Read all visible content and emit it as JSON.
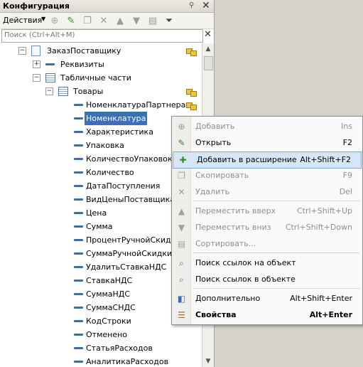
{
  "window": {
    "title": "Конфигурация"
  },
  "toolbar": {
    "actions_label": "Действия"
  },
  "search": {
    "placeholder": "Поиск (Ctrl+Alt+M)"
  },
  "tree": {
    "root": "ЗаказПоставщику",
    "requisites": "Реквизиты",
    "tabular_parts": "Табличные части",
    "table_goods": "Товары",
    "attributes": [
      "НоменклатураПартнера",
      "Номенклатура",
      "Характеристика",
      "Упаковка",
      "КоличествоУпаковок",
      "Количество",
      "ДатаПоступления",
      "ВидЦеныПоставщика",
      "Цена",
      "Сумма",
      "ПроцентРучнойСкидки",
      "СуммаРучнойСкидки",
      "УдалитьСтавкаНДС",
      "СтавкаНДС",
      "СуммаНДС",
      "СуммаСНДС",
      "КодСтроки",
      "Отменено",
      "СтатьяРасходов",
      "АналитикаРасходов"
    ]
  },
  "context_menu": {
    "items": [
      {
        "label": "Добавить",
        "shortcut": "Ins",
        "icon": "add-icon",
        "disabled": true
      },
      {
        "label": "Открыть",
        "shortcut": "F2",
        "icon": "pencil-icon",
        "disabled": false
      },
      {
        "label": "Добавить в расширение",
        "shortcut": "Alt+Shift+F2",
        "icon": "add-to-extension-icon",
        "disabled": false,
        "highlighted": true
      },
      {
        "label": "Скопировать",
        "shortcut": "F9",
        "icon": "copy-icon",
        "disabled": true
      },
      {
        "label": "Удалить",
        "shortcut": "Del",
        "icon": "delete-icon",
        "disabled": true
      },
      {
        "label": "Переместить вверх",
        "shortcut": "Ctrl+Shift+Up",
        "icon": "arrow-up-icon",
        "disabled": true
      },
      {
        "label": "Переместить вниз",
        "shortcut": "Ctrl+Shift+Down",
        "icon": "arrow-down-icon",
        "disabled": true
      },
      {
        "label": "Сортировать...",
        "shortcut": "",
        "icon": "sort-icon",
        "disabled": true
      },
      {
        "label": "Поиск ссылок на объект",
        "shortcut": "",
        "icon": "find-refs-icon",
        "disabled": false
      },
      {
        "label": "Поиск ссылок в объекте",
        "shortcut": "",
        "icon": "find-refs-in-icon",
        "disabled": false
      },
      {
        "label": "Дополнительно",
        "shortcut": "Alt+Shift+Enter",
        "icon": "additional-icon",
        "disabled": false
      },
      {
        "label": "Свойства",
        "shortcut": "Alt+Enter",
        "icon": "properties-icon",
        "disabled": false,
        "bold": true
      }
    ]
  }
}
